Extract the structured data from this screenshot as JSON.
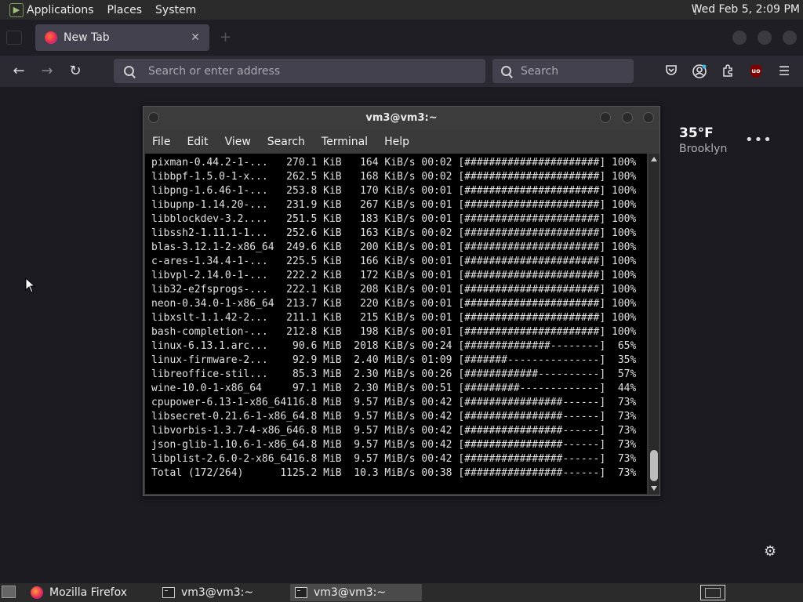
{
  "system_panel": {
    "menus": [
      "Applications",
      "Places",
      "System"
    ],
    "clock": "Wed Feb  5, 2:09 PM"
  },
  "browser": {
    "tab": {
      "title": "New Tab"
    },
    "urlbar": {
      "placeholder": "Search or enter address"
    },
    "searchbox": {
      "placeholder": "Search"
    },
    "toolbar_icons": [
      "back-icon",
      "forward-icon",
      "reload-icon",
      "pocket-icon",
      "account-icon",
      "extensions-icon",
      "ublock-icon",
      "menu-icon"
    ],
    "ublock_label": "uo",
    "weather": {
      "temp": "35°F",
      "city": "Brooklyn"
    }
  },
  "terminal": {
    "title": "vm3@vm3:~",
    "menu": [
      "File",
      "Edit",
      "View",
      "Search",
      "Terminal",
      "Help"
    ],
    "lines": [
      "pixman-0.44.2-1-...   270.1 KiB   164 KiB/s 00:02 [######################] 100%",
      "libbpf-1.5.0-1-x...   262.5 KiB   168 KiB/s 00:02 [######################] 100%",
      "libpng-1.6.46-1-...   253.8 KiB   170 KiB/s 00:01 [######################] 100%",
      "libupnp-1.14.20-...   231.9 KiB   267 KiB/s 00:01 [######################] 100%",
      "libblockdev-3.2....   251.5 KiB   183 KiB/s 00:01 [######################] 100%",
      "libssh2-1.11.1-1...   252.6 KiB   163 KiB/s 00:02 [######################] 100%",
      "blas-3.12.1-2-x86_64  249.6 KiB   200 KiB/s 00:01 [######################] 100%",
      "c-ares-1.34.4-1-...   225.5 KiB   166 KiB/s 00:01 [######################] 100%",
      "libvpl-2.14.0-1-...   222.2 KiB   172 KiB/s 00:01 [######################] 100%",
      "lib32-e2fsprogs-...   222.1 KiB   208 KiB/s 00:01 [######################] 100%",
      "neon-0.34.0-1-x86_64  213.7 KiB   220 KiB/s 00:01 [######################] 100%",
      "libxslt-1.1.42-2...   211.1 KiB   215 KiB/s 00:01 [######################] 100%",
      "bash-completion-...   212.8 KiB   198 KiB/s 00:01 [######################] 100%",
      "linux-6.13.1.arc...    90.6 MiB  2018 KiB/s 00:24 [##############--------]  65%",
      "linux-firmware-2...    92.9 MiB  2.40 MiB/s 01:09 [#######---------------]  35%",
      "libreoffice-stil...    85.3 MiB  2.30 MiB/s 00:26 [############----------]  57%",
      "wine-10.0-1-x86_64     97.1 MiB  2.30 MiB/s 00:51 [#########-------------]  44%",
      "cpupower-6.13-1-x86_64116.8 MiB  9.57 MiB/s 00:42 [################------]  73%",
      "libsecret-0.21.6-1-x86_64.8 MiB  9.57 MiB/s 00:42 [################------]  73%",
      "libvorbis-1.3.7-4-x86_646.8 MiB  9.57 MiB/s 00:42 [################------]  73%",
      "json-glib-1.10.6-1-x86_64.8 MiB  9.57 MiB/s 00:42 [################------]  73%",
      "libplist-2.6.0-2-x86_6416.8 MiB  9.57 MiB/s 00:42 [################------]  73%",
      "Total (172/264)      1125.2 MiB  10.3 MiB/s 00:38 [################------]  73%"
    ]
  },
  "taskbar": {
    "items": [
      {
        "label": "Mozilla Firefox",
        "icon": "firefox-icon",
        "active": false
      },
      {
        "label": "vm3@vm3:~",
        "icon": "terminal-icon",
        "active": false
      },
      {
        "label": "vm3@vm3:~",
        "icon": "terminal-icon",
        "active": true
      }
    ]
  }
}
